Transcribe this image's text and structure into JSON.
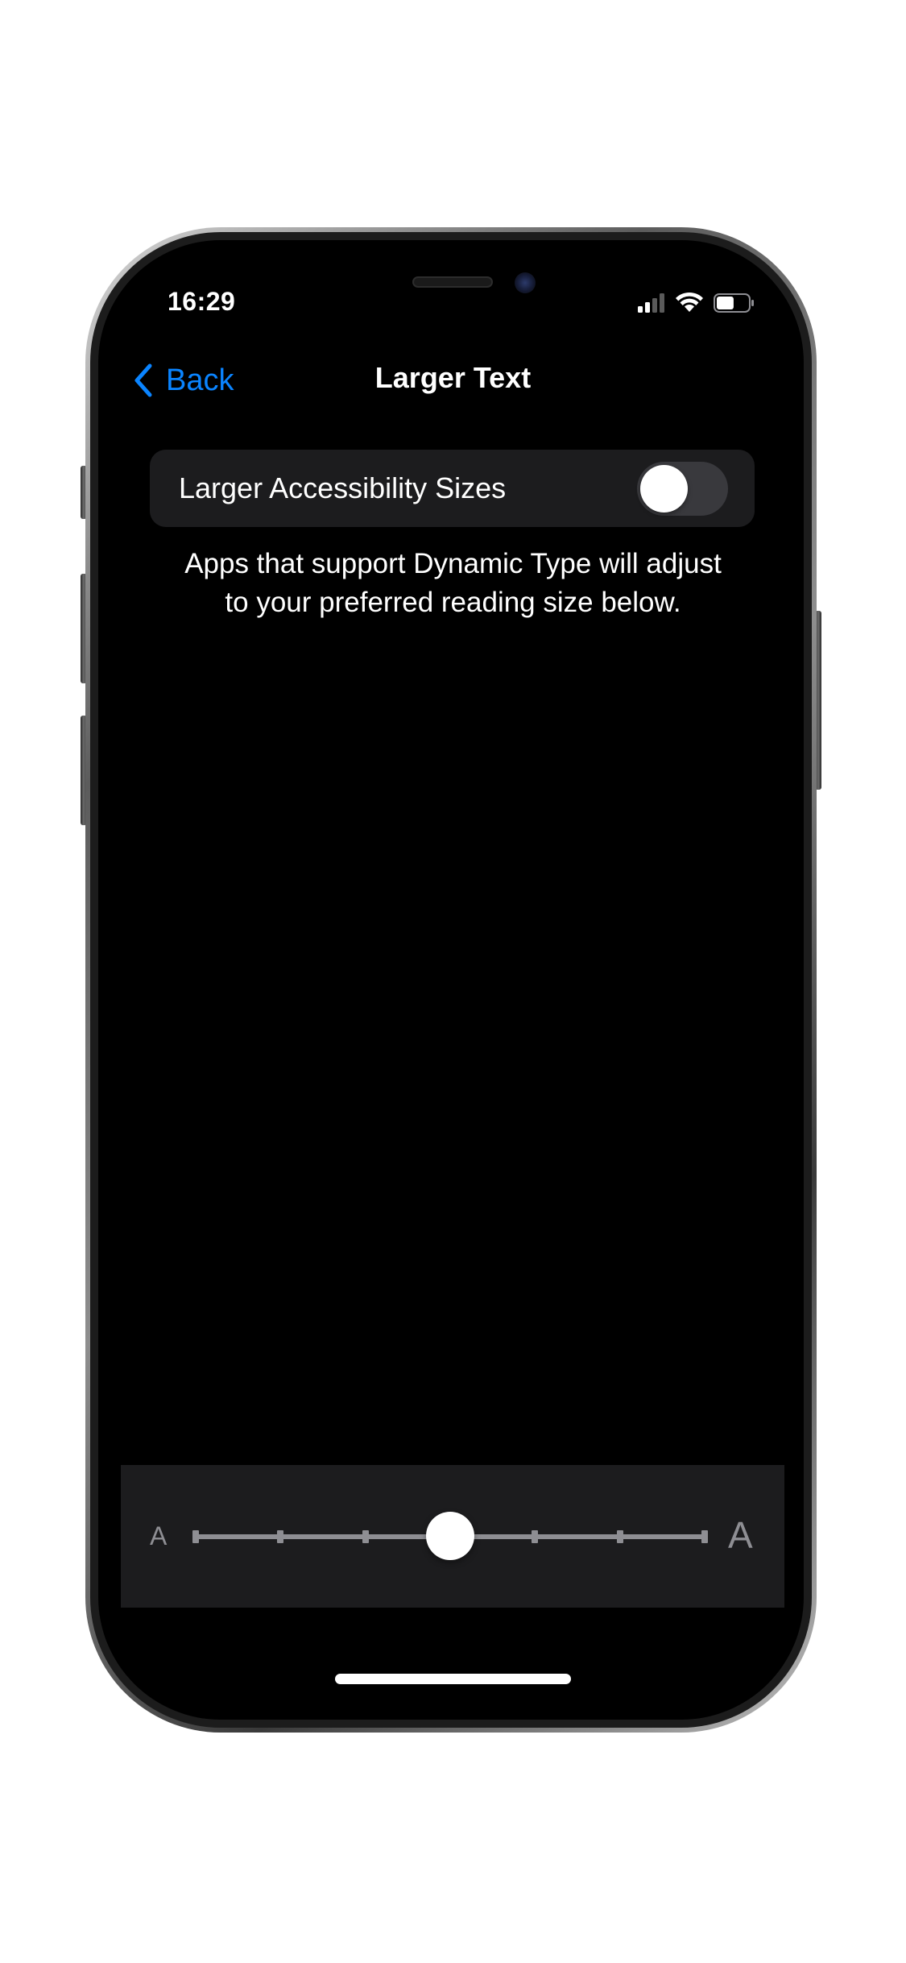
{
  "status_bar": {
    "time": "16:29",
    "icons": [
      "cellular-signal-icon",
      "wifi-icon",
      "battery-icon"
    ],
    "battery_level": 0.55
  },
  "nav": {
    "back_label": "Back",
    "title": "Larger Text"
  },
  "settings": {
    "larger_accessibility_sizes": {
      "label": "Larger Accessibility Sizes",
      "enabled": false
    },
    "footer": "Apps that support Dynamic Type will adjust to your preferred reading size below."
  },
  "text_size_slider": {
    "min_glyph": "A",
    "max_glyph": "A",
    "steps": 7,
    "selected_index": 3
  },
  "colors": {
    "accent": "#0a84ff",
    "background": "#000000",
    "cell": "#1c1c1e",
    "toggle_off": "#39393d",
    "secondary": "#8e8e93"
  }
}
